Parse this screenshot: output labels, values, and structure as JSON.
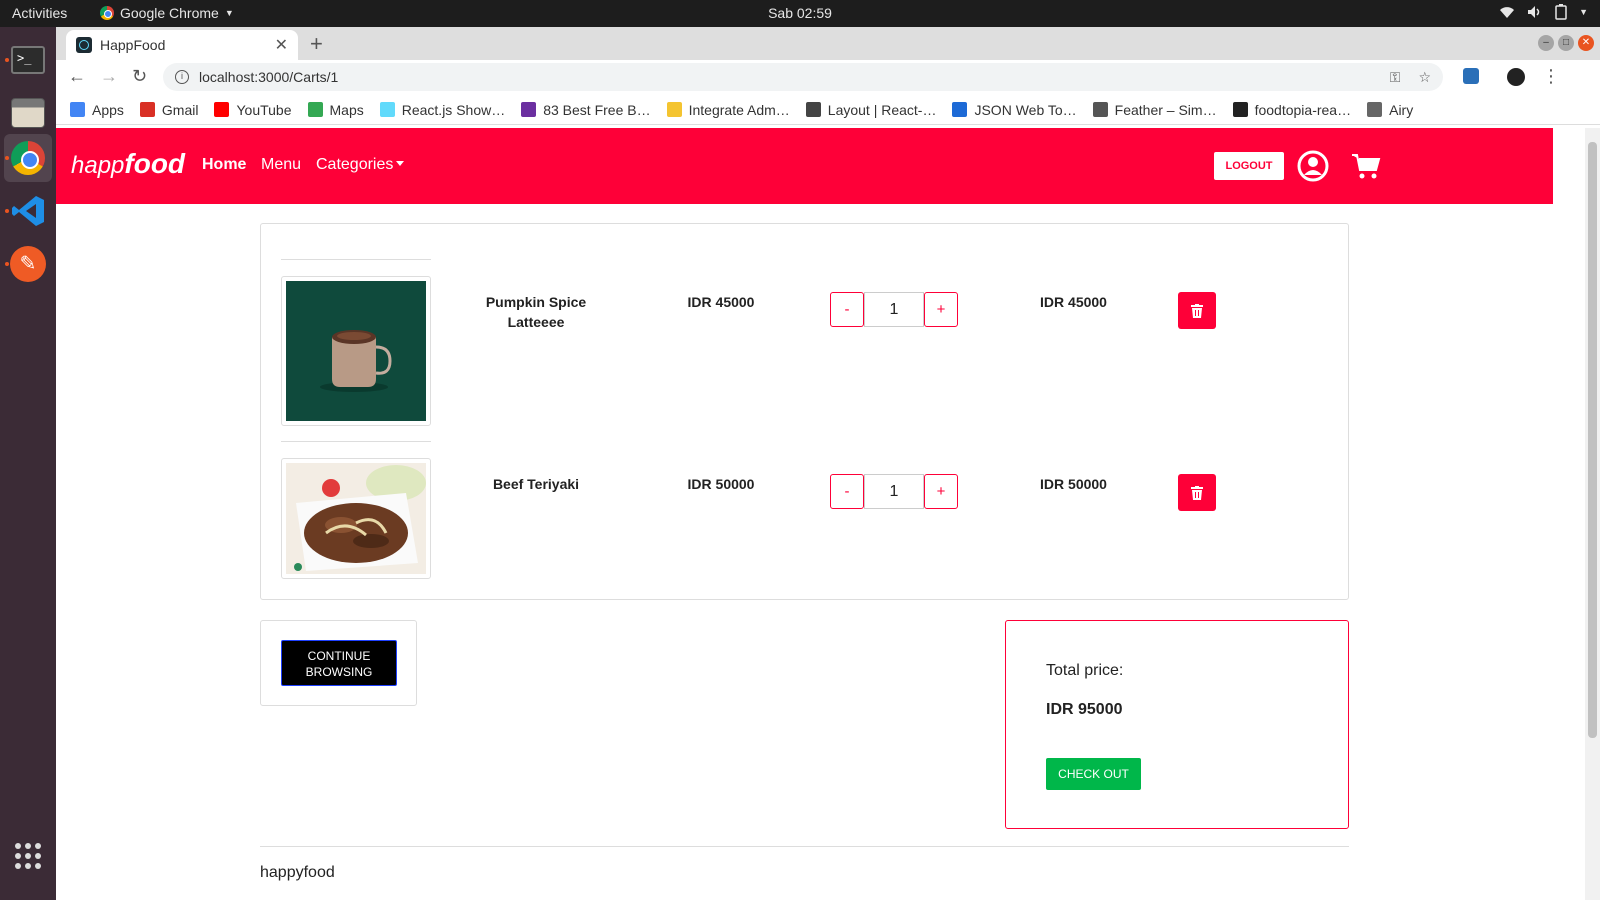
{
  "os": {
    "activities": "Activities",
    "app_name": "Google Chrome",
    "clock": "Sab 02:59"
  },
  "browser": {
    "tab_title": "HappFood",
    "url": "localhost:3000/Carts/1",
    "bookmarks": [
      {
        "label": "Apps",
        "icon": "apps-grid-icon",
        "color": "#4285f4"
      },
      {
        "label": "Gmail",
        "icon": "gmail-icon",
        "color": "#d93025"
      },
      {
        "label": "YouTube",
        "icon": "youtube-icon",
        "color": "#ff0000"
      },
      {
        "label": "Maps",
        "icon": "maps-icon",
        "color": "#34a853"
      },
      {
        "label": "React.js Show…",
        "icon": "react-icon",
        "color": "#61dafb"
      },
      {
        "label": "83 Best Free B…",
        "icon": "colorlib-icon",
        "color": "#6b2fa0"
      },
      {
        "label": "Integrate Adm…",
        "icon": "pen-icon",
        "color": "#f4c430"
      },
      {
        "label": "Layout | React-…",
        "icon": "globe-icon",
        "color": "#444444"
      },
      {
        "label": "JSON Web To…",
        "icon": "jwt-icon",
        "color": "#1d6ad6"
      },
      {
        "label": "Feather – Sim…",
        "icon": "feather-icon",
        "color": "#555555"
      },
      {
        "label": "foodtopia-rea…",
        "icon": "github-icon",
        "color": "#222222"
      },
      {
        "label": "Airy",
        "icon": "folder-icon",
        "color": "#666666"
      }
    ]
  },
  "app": {
    "brand_light": "happ",
    "brand_bold": "food",
    "nav": {
      "home": "Home",
      "menu": "Menu",
      "categories": "Categories"
    },
    "logout": "LOGOUT",
    "accent": "#fe0038"
  },
  "cart": {
    "items": [
      {
        "name": "Pumpkin Spice Latteeee",
        "price": "IDR 45000",
        "qty": "1",
        "subtotal": "IDR 45000",
        "minus": "-",
        "plus": "+"
      },
      {
        "name": "Beef Teriyaki",
        "price": "IDR 50000",
        "qty": "1",
        "subtotal": "IDR 50000",
        "minus": "-",
        "plus": "+"
      }
    ],
    "continue_label": "CONTINUE BROWSING",
    "total_label": "Total price:",
    "total_value": "IDR 95000",
    "checkout_label": "CHECK OUT"
  },
  "footer": {
    "text": "happyfood"
  }
}
